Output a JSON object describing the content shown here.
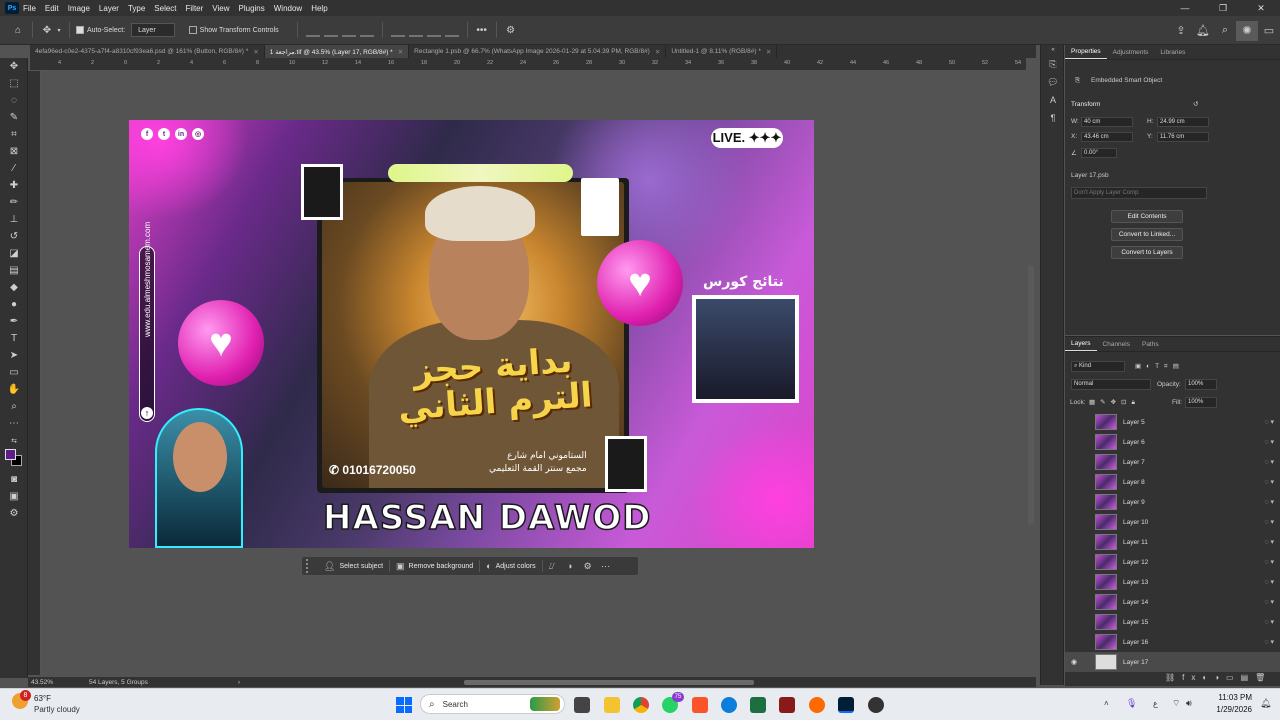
{
  "menu": {
    "items": [
      "File",
      "Edit",
      "Image",
      "Layer",
      "Type",
      "Select",
      "Filter",
      "View",
      "Plugins",
      "Window",
      "Help"
    ],
    "logo": "Ps"
  },
  "options": {
    "auto_select": "Auto-Select:",
    "layer_select": "Layer",
    "show_transform": "Show Transform Controls"
  },
  "tabs": [
    {
      "label": "4efa96ed-c0e2-4375-a7f4-a8310cf93ea6.psd @ 161% (Button, RGB/8#) *"
    },
    {
      "label": "1 مراجعة.tif @ 43.5% (Layer 17, RGB/8#) *"
    },
    {
      "label": "Rectangle 1.psb @ 66.7% (WhatsApp Image 2026-01-29 at 5.04.39 PM, RGB/8#)"
    },
    {
      "label": "Untitled-1 @ 8.11% (RGB/8#) *"
    }
  ],
  "ruler_top": [
    "4",
    "2",
    "0",
    "2",
    "4",
    "6",
    "8",
    "10",
    "12",
    "14",
    "16",
    "18",
    "20",
    "22",
    "24",
    "26",
    "28",
    "30",
    "32",
    "34",
    "36",
    "38",
    "40",
    "42",
    "44",
    "46",
    "48",
    "50",
    "52",
    "54"
  ],
  "canvas": {
    "live": "LIVE. ✦✦✦",
    "website": "www.edu.almeshmosamem.com",
    "arabic_big": "بداية حجز الترم الثاني",
    "phone": "01016720050",
    "address_line1": "الستاموني امام شارع",
    "address_line2": "مجمع سنتر القمة التعليمي",
    "result_title": "نتائج كورس",
    "name": "HASSAN DAWOD"
  },
  "context_bar": {
    "select_subject": "Select subject",
    "remove_background": "Remove background",
    "adjust_colors": "Adjust colors"
  },
  "status": {
    "zoom": "43.52%",
    "info": "54 Layers, 5 Groups"
  },
  "properties": {
    "tabs": [
      "Properties",
      "Adjustments",
      "Libraries"
    ],
    "type": "Embedded Smart Object",
    "transform": "Transform",
    "w_label": "W:",
    "w": "40 cm",
    "h_label": "H:",
    "h": "24.99 cm",
    "x_label": "X:",
    "x": "43.46 cm",
    "y_label": "Y:",
    "y": "11.76 cm",
    "angle": "0.00°",
    "layer_name": "Layer 17.psb",
    "layer_comp": "Don't Apply Layer Comp",
    "buttons": [
      "Edit Contents",
      "Convert to Linked...",
      "Convert to Layers"
    ]
  },
  "layers_panel": {
    "tabs": [
      "Layers",
      "Channels",
      "Paths"
    ],
    "kind": "Kind",
    "blend": "Normal",
    "opacity_label": "Opacity:",
    "opacity": "100%",
    "lock_label": "Lock:",
    "fill_label": "Fill:",
    "fill": "100%",
    "layers": [
      "Layer 5",
      "Layer 6",
      "Layer 7",
      "Layer 8",
      "Layer 9",
      "Layer 10",
      "Layer 11",
      "Layer 12",
      "Layer 13",
      "Layer 14",
      "Layer 15",
      "Layer 16",
      "Layer 17"
    ]
  },
  "taskbar": {
    "weather_temp": "63°F",
    "weather_desc": "Partly cloudy",
    "search": "Search",
    "time": "11:03 PM",
    "date": "1/29/2026",
    "notif": "8",
    "badge": "75"
  }
}
